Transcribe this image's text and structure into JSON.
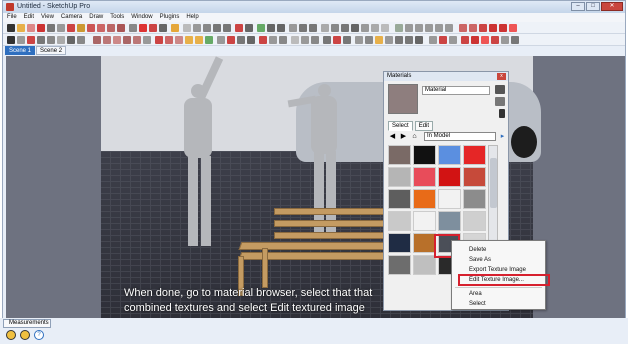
{
  "window": {
    "title": "Untitled - SketchUp Pro",
    "controls": [
      "–",
      "□",
      "✕"
    ]
  },
  "menu": [
    "File",
    "Edit",
    "View",
    "Camera",
    "Draw",
    "Tools",
    "Window",
    "Plugins",
    "Help"
  ],
  "scene_tabs": [
    "Scene 1",
    "Scene 2"
  ],
  "caption": {
    "line1": "When done, go to material browser, select that that",
    "line2": "combined textures and select Edit textured image"
  },
  "materials": {
    "panel_title": "Materials",
    "close_label": "x",
    "material_name": "Material",
    "tabs": [
      "Select",
      "Edit"
    ],
    "library_select": "In Model",
    "nav_icons": [
      "back-icon",
      "forward-icon",
      "home-icon"
    ]
  },
  "context_menu": {
    "items": [
      "Delete",
      "Save As",
      "Export Texture Image",
      "Edit Texture Image...",
      "Area",
      "Select"
    ]
  },
  "status": {
    "measurements_label": "Measurements"
  },
  "colors": {
    "accent": "#2f6fbf",
    "highlight": "#d6202e",
    "bench": "#c49b62"
  },
  "swatches": [
    "#7a6a66",
    "#111111",
    "#5b8fe0",
    "#e52626",
    "#b5b5b5",
    "#e84c5a",
    "#d21313",
    "#c64a3a",
    "#5e5e5e",
    "#e86b18",
    "#f2f2f2",
    "#8c8c8c",
    "#c9c9c9",
    "#f2f2f2",
    "#7e8f9e",
    "#cfcfcf",
    "#1f2c44",
    "#b8702a",
    "#4b4f58",
    "#d5d5d5",
    "#6d6d6d",
    "#bfbfbf",
    "#2a2a2a",
    "#909090"
  ]
}
